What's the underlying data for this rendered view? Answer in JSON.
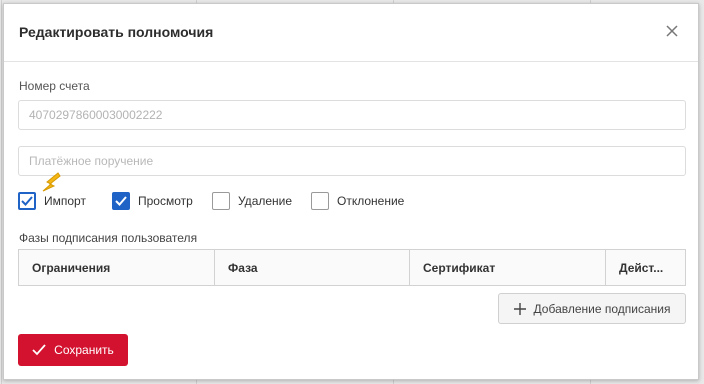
{
  "dialog": {
    "title": "Редактировать полномочия",
    "close_icon": "close-icon"
  },
  "account": {
    "label": "Номер счета",
    "value": "40702978600030002222"
  },
  "document": {
    "placeholder": "Платёжное поручение"
  },
  "permissions": [
    {
      "label": "Импорт",
      "checked": true
    },
    {
      "label": "Просмотр",
      "checked": true
    },
    {
      "label": "Удаление",
      "checked": false
    },
    {
      "label": "Отклонение",
      "checked": false
    }
  ],
  "phases": {
    "label": "Фазы подписания пользователя",
    "columns": [
      "Ограничения",
      "Фаза",
      "Сертификат",
      "Дейст..."
    ]
  },
  "buttons": {
    "add_signature": "Добавление подписания",
    "save": "Сохранить"
  },
  "colors": {
    "accent": "#1f63c6",
    "save": "#d3122f",
    "pointer": "#f3b614"
  }
}
